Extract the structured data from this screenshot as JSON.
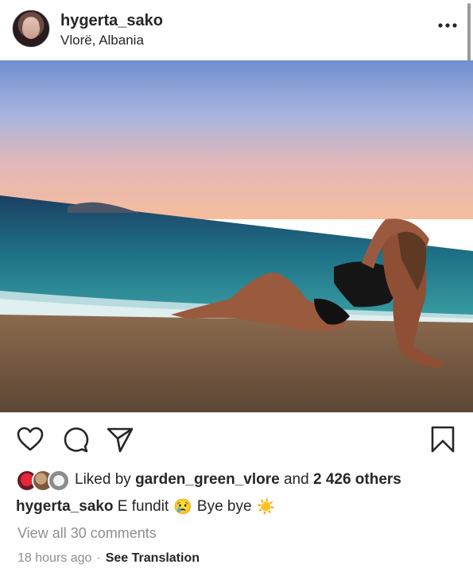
{
  "post": {
    "username": "hygerta_sako",
    "location": "Vlorë, Albania",
    "more_icon": "more-horizontal-icon"
  },
  "actions": {
    "icons": [
      "heart-icon",
      "comment-icon",
      "share-icon",
      "bookmark-icon"
    ]
  },
  "likes": {
    "prefix": "Liked by",
    "user": "garden_green_vlore",
    "and_text": "and",
    "others": "2 426 others"
  },
  "caption": {
    "username": "hygerta_sako",
    "text_1": "E fundit",
    "emoji_1": "😢",
    "text_2": "Bye bye",
    "emoji_2": "☀️"
  },
  "comments": {
    "view_all": "View all 30 comments"
  },
  "meta": {
    "time": "18 hours ago",
    "separator": "·",
    "translation": "See Translation"
  }
}
